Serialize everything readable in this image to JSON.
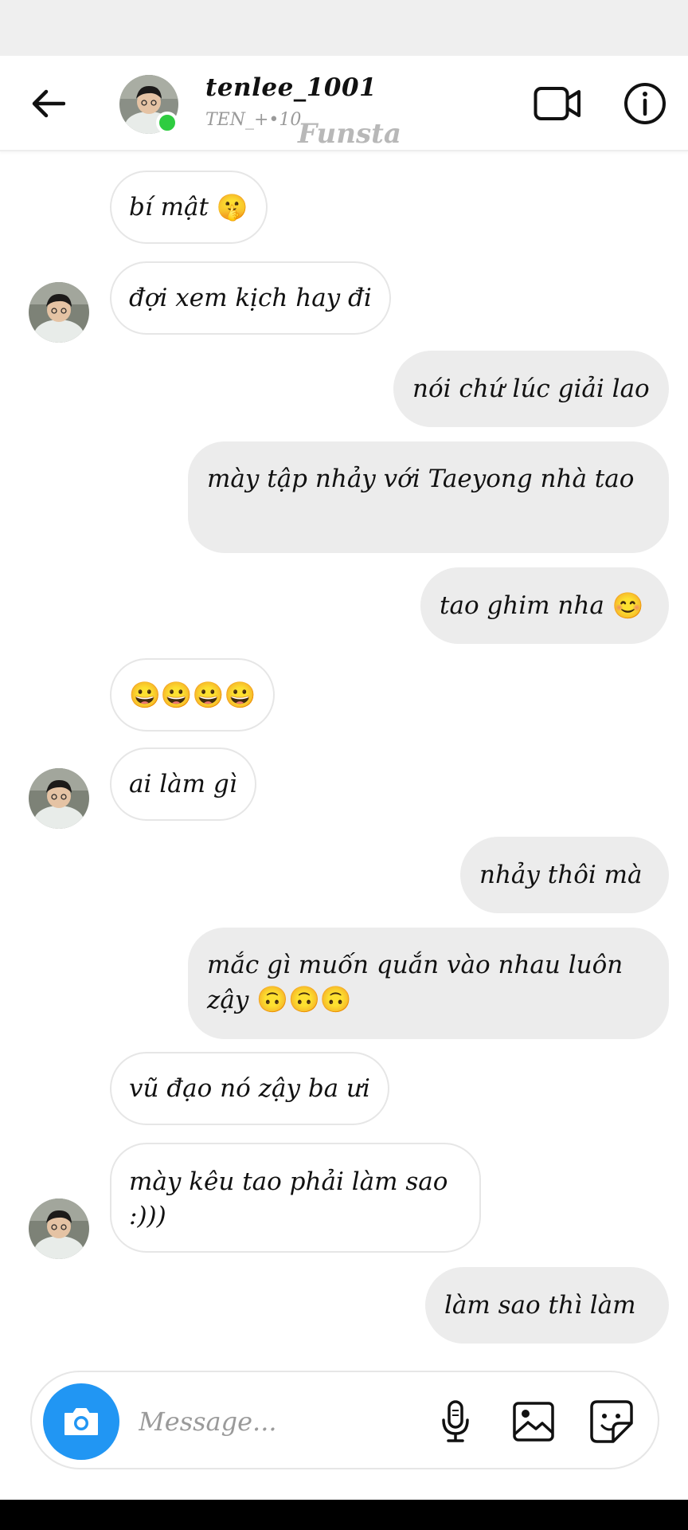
{
  "header": {
    "username": "tenlee_1001",
    "subname": "TEN_+•10",
    "watermark": "Funsta"
  },
  "messages": [
    {
      "side": "in",
      "text": "bí mật",
      "emoji": "🤫"
    },
    {
      "side": "in",
      "text": "đợi xem kịch hay đi",
      "emoji": ""
    },
    {
      "side": "out",
      "text": "nói chứ lúc giải lao",
      "emoji": ""
    },
    {
      "side": "out",
      "text": "mày tập nhảy với Taeyong nhà tao",
      "emoji": ""
    },
    {
      "side": "out",
      "text": "tao ghim nha",
      "emoji": "😊"
    },
    {
      "side": "in",
      "text": "",
      "emoji": "😀😀😀😀"
    },
    {
      "side": "in",
      "text": "ai làm gì",
      "emoji": ""
    },
    {
      "side": "out",
      "text": "nhảy thôi mà",
      "emoji": ""
    },
    {
      "side": "out",
      "text": "mắc gì muốn quắn vào nhau luôn zậy",
      "emoji": "🙃🙃🙃"
    },
    {
      "side": "in",
      "text": "vũ đạo nó zậy ba ưi",
      "emoji": ""
    },
    {
      "side": "in",
      "text": "mày kêu tao phải làm sao :)))",
      "emoji": ""
    },
    {
      "side": "out",
      "text": "làm sao thì làm",
      "emoji": ""
    }
  ],
  "composer": {
    "placeholder": "Message..."
  },
  "icons": {
    "back": "arrow-left-icon",
    "video": "video-camera-icon",
    "info": "info-icon",
    "camera": "camera-icon",
    "mic": "microphone-icon",
    "gallery": "image-icon",
    "sticker": "sticker-icon"
  },
  "colors": {
    "online": "#2ecc40",
    "camera_button": "#2196f3",
    "outgoing_bubble": "#ececec",
    "incoming_border": "#e6e6e6"
  }
}
